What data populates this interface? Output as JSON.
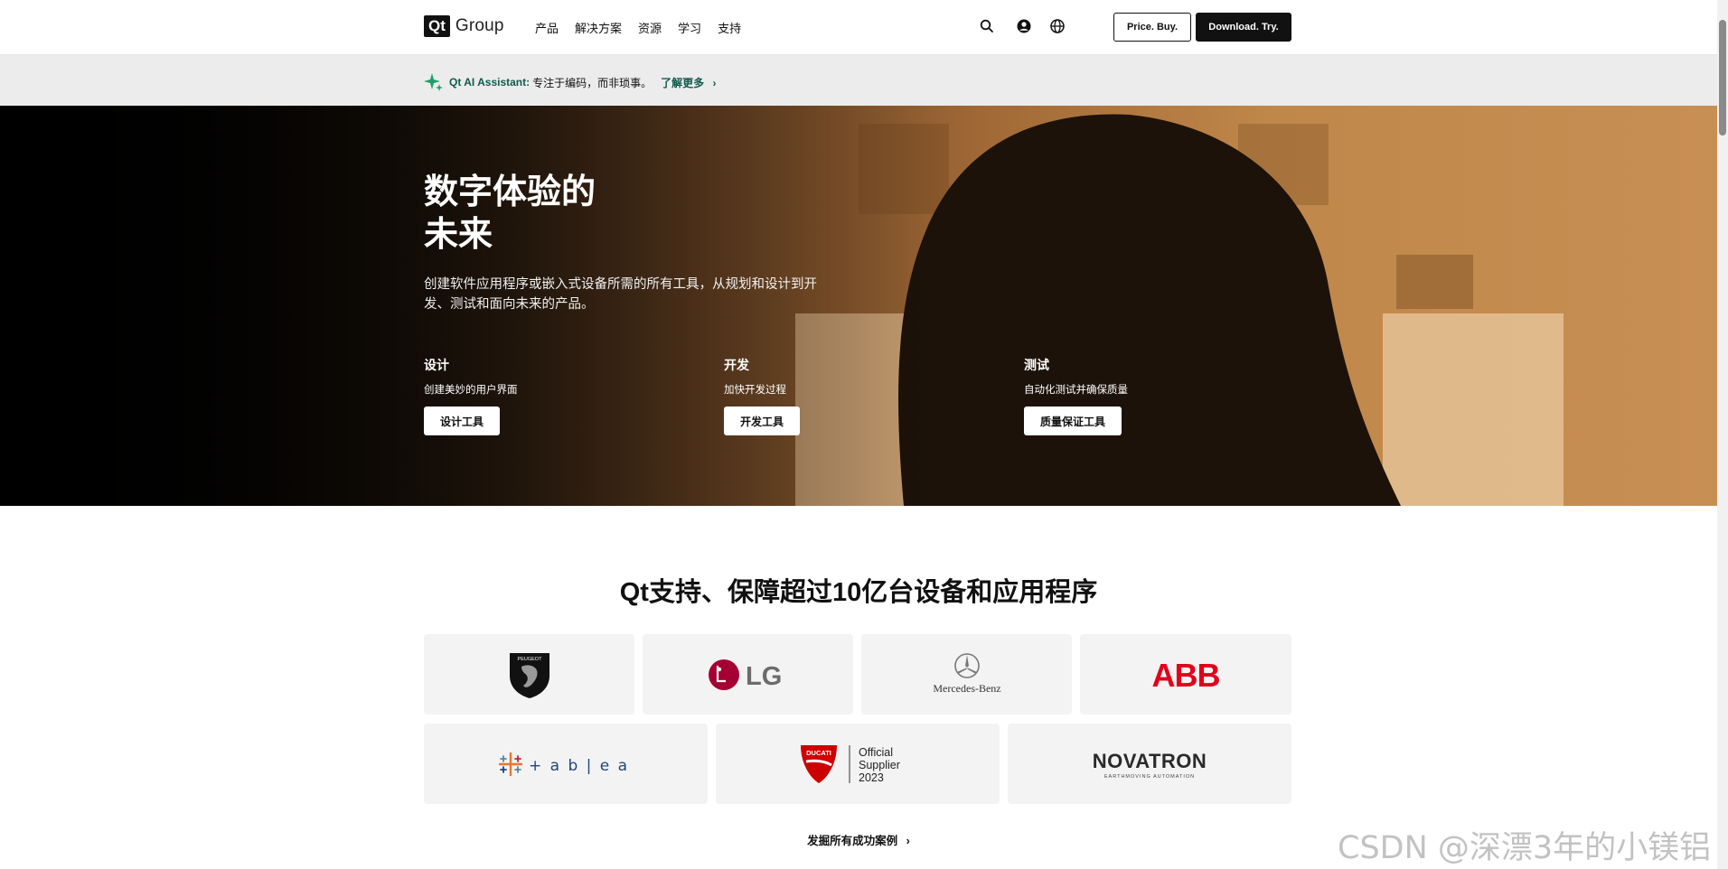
{
  "nav": {
    "logo_mark": "Qt",
    "logo_text": "Group",
    "links": [
      "产品",
      "解决方案",
      "资源",
      "学习",
      "支持"
    ],
    "price_button": "Price. Buy.",
    "download_button": "Download. Try."
  },
  "announcement": {
    "label": "Qt AI Assistant:",
    "text": "专注于编码，而非琐事。",
    "link": "了解更多"
  },
  "hero": {
    "title": "数字体验的\n未来",
    "description": "创建软件应用程序或嵌入式设备所需的所有工具，从规划和设计到开发、测试和面向未来的产品。",
    "columns": [
      {
        "title": "设计",
        "subtitle": "创建美妙的用户界面",
        "button": "设计工具"
      },
      {
        "title": "开发",
        "subtitle": "加快开发过程",
        "button": "开发工具"
      },
      {
        "title": "测试",
        "subtitle": "自动化测试并确保质量",
        "button": "质量保证工具"
      }
    ]
  },
  "customers": {
    "title": "Qt支持、保障超过10亿台设备和应用程序",
    "logos": {
      "peugeot": "PEUGEOT",
      "lg": "LG",
      "mercedes": "Mercedes-Benz",
      "abb": "ABB",
      "tableau": "+ a b | e a u",
      "ducati_badge": "DUCATI",
      "ducati": [
        "Official",
        "Supplier",
        "2023"
      ],
      "novatron": "NOVATRON",
      "novatron_sub": "EARTHMOVING AUTOMATION"
    },
    "see_all": "发掘所有成功案例"
  },
  "watermark": "CSDN @深漂3年的小镁铝",
  "colors": {
    "accent": "#0f5a4b",
    "abb_red": "#e2001a",
    "lg_red": "#a50034",
    "ducati_red": "#cc0000"
  }
}
